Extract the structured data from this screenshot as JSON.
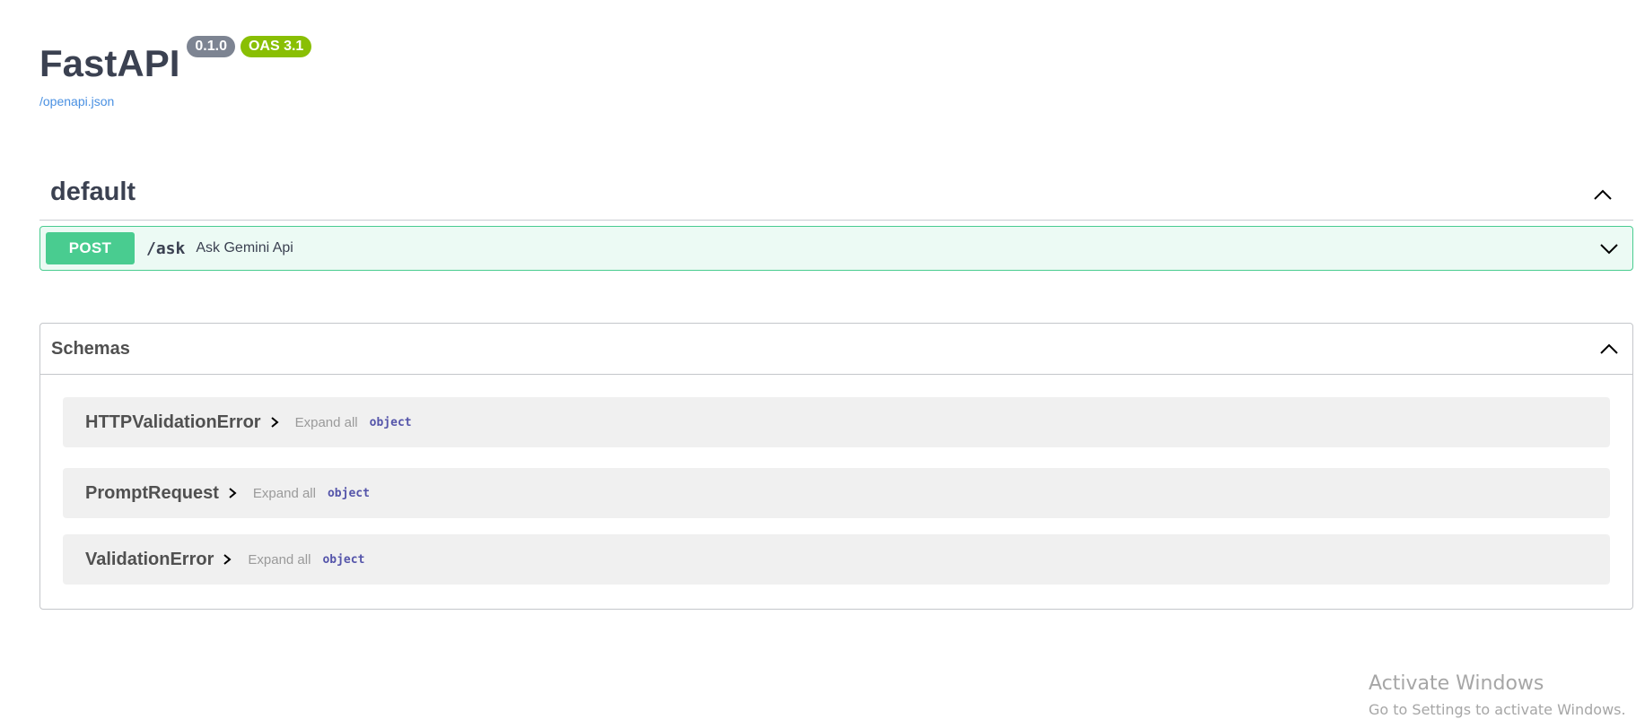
{
  "header": {
    "title": "FastAPI",
    "version_badge": "0.1.0",
    "oas_badge": "OAS 3.1",
    "spec_link": "/openapi.json"
  },
  "tag_section": {
    "name": "default",
    "toggle_icon": "chevron-up-icon",
    "operations": [
      {
        "method": "POST",
        "path": "/ask",
        "summary": "Ask Gemini Api",
        "toggle_icon": "chevron-down-icon"
      }
    ]
  },
  "schemas": {
    "title": "Schemas",
    "toggle_icon": "chevron-up-icon",
    "models": [
      {
        "name": "HTTPValidationError",
        "expand_label": "Expand all",
        "type": "object"
      },
      {
        "name": "PromptRequest",
        "expand_label": "Expand all",
        "type": "object"
      },
      {
        "name": "ValidationError",
        "expand_label": "Expand all",
        "type": "object"
      }
    ]
  },
  "watermark": {
    "title": "Activate Windows",
    "subtitle": "Go to Settings to activate Windows."
  },
  "colors": {
    "post_method": "#49cc90",
    "version_badge": "#7d8492",
    "oas_badge": "#89bf04",
    "link": "#4990e2"
  }
}
